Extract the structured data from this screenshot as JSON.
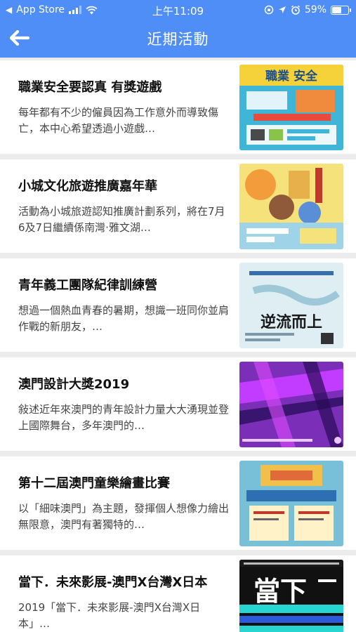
{
  "status_bar": {
    "carrier": "App Store",
    "time": "上午11:09",
    "battery": "59%",
    "battery_level": 0.59
  },
  "header": {
    "title": "近期活動",
    "back_icon": "arrow-left-icon"
  },
  "colors": {
    "header_bg": "#4f8ef7",
    "list_bg": "#ececec",
    "card_bg": "#ffffff"
  },
  "activities": [
    {
      "title": "職業安全要認真 有獎遊戲",
      "description": "每年都有不少的僱員因為工作意外而導致傷亡，本中心希望透過小遊戲…",
      "poster_text": "職業 安全"
    },
    {
      "title": "小城文化旅遊推廣嘉年華",
      "description": "活動為小城旅遊認知推廣計劃系列，將在7月6及7日繼續係南灣·雅文湖…",
      "poster_text": ""
    },
    {
      "title": "青年義工團隊紀律訓練營",
      "description": "想過一個熱血青春的暑期，想識一班同你並肩作戰的新朋友，…",
      "poster_text": "逆流而上"
    },
    {
      "title": "澳門設計大獎2019",
      "description": "敍述近年來澳門的青年設計力量大大湧現並登上國際舞台，多年澳門的…",
      "poster_text": ""
    },
    {
      "title": "第十二屆澳門童樂繪畫比賽",
      "description": "以「細味澳門」為主題，發揮個人想像力繪出無限意，澳門有著獨特的…",
      "poster_text": ""
    },
    {
      "title": "當下．未來影展-澳門X台灣X日本",
      "description": "2019「當下．未來影展-澳門X台灣X日本」…",
      "poster_text": "當下"
    }
  ]
}
